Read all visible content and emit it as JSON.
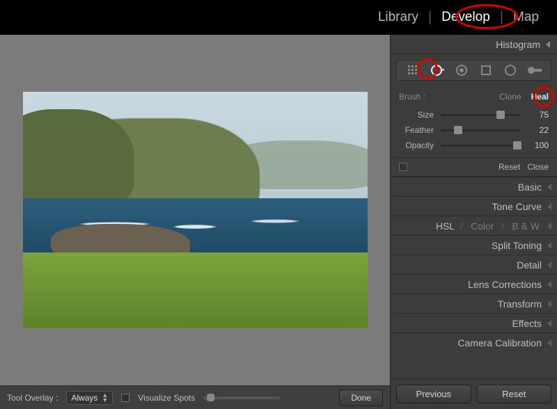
{
  "topnav": {
    "tabs": [
      "Library",
      "Develop",
      "Map"
    ],
    "active": "Develop"
  },
  "histogram": {
    "title": "Histogram"
  },
  "toolstrip": {
    "tools": [
      "crop-icon",
      "spot-removal-icon",
      "redeye-icon",
      "graduated-filter-icon",
      "radial-filter-icon",
      "adjustment-brush-icon"
    ],
    "active": "spot-removal-icon"
  },
  "brush": {
    "label": "Brush :",
    "modes": {
      "clone": "Clone",
      "heal": "Heal"
    },
    "activeMode": "heal",
    "sliders": {
      "size": {
        "label": "Size",
        "value": 75,
        "pct": 75
      },
      "feather": {
        "label": "Feather",
        "value": 22,
        "pct": 22
      },
      "opacity": {
        "label": "Opacity",
        "value": 100,
        "pct": 96
      }
    },
    "reset": "Reset",
    "close": "Close"
  },
  "rightPanels": [
    {
      "label": "Basic"
    },
    {
      "label": "Tone Curve"
    },
    {
      "segmented": [
        "HSL",
        "Color",
        "B & W"
      ],
      "active": "HSL"
    },
    {
      "label": "Split Toning"
    },
    {
      "label": "Detail"
    },
    {
      "label": "Lens Corrections"
    },
    {
      "label": "Transform"
    },
    {
      "label": "Effects"
    },
    {
      "label": "Camera Calibration"
    }
  ],
  "footer": {
    "previous": "Previous",
    "reset": "Reset"
  },
  "bottombar": {
    "toolOverlayLabel": "Tool Overlay :",
    "toolOverlayValue": "Always",
    "visualizeSpots": "Visualize Spots",
    "done": "Done"
  }
}
